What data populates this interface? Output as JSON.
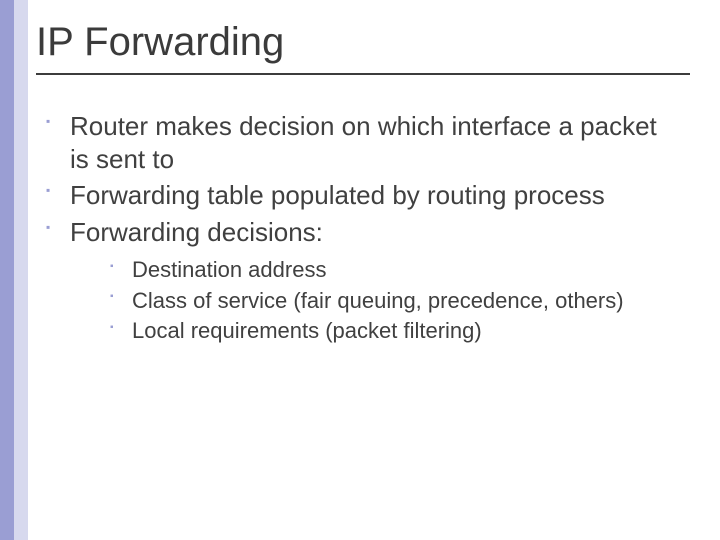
{
  "title": "IP Forwarding",
  "bullets": [
    "Router makes decision on which interface a packet is sent to",
    "Forwarding table populated by routing process",
    "Forwarding decisions:"
  ],
  "sub_bullets": [
    "Destination address",
    "Class of service (fair queuing, precedence, others)",
    "Local requirements (packet filtering)"
  ],
  "colors": {
    "sidebar_light": "#d7d9ee",
    "sidebar_dark": "#9a9ed3",
    "text": "#404040"
  }
}
